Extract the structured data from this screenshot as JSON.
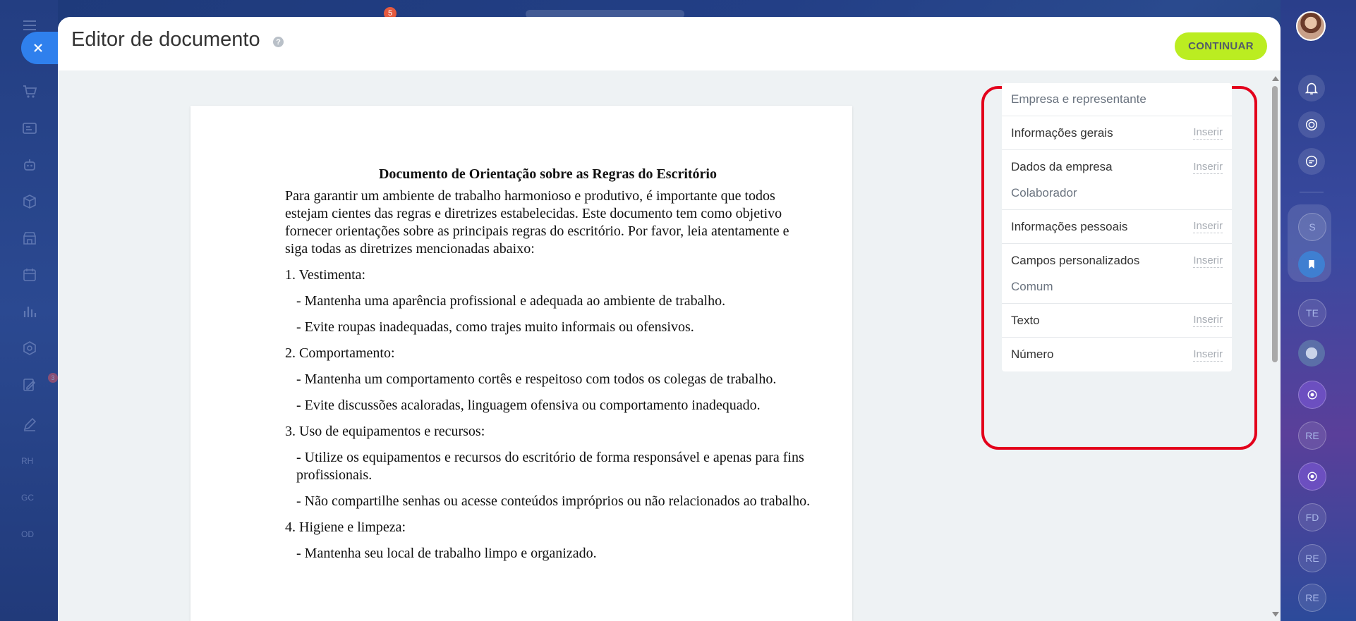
{
  "background": {
    "notification_badge": "5"
  },
  "left_rail": {
    "items": [
      {
        "icon": "cart-icon"
      },
      {
        "icon": "contact-card-icon"
      },
      {
        "icon": "robot-icon"
      },
      {
        "icon": "box-icon"
      },
      {
        "icon": "store-icon"
      },
      {
        "icon": "calendar-icon"
      },
      {
        "icon": "bar-chart-icon"
      },
      {
        "icon": "hexagon-icon"
      },
      {
        "icon": "sign-document-icon",
        "badge": "3"
      },
      {
        "icon": "pen-icon"
      }
    ],
    "text_items": [
      "RH",
      "GC",
      "OD"
    ]
  },
  "right_rail": {
    "avatars": [
      "S",
      "TE",
      "RE",
      "FD",
      "RE",
      "RE"
    ]
  },
  "header": {
    "title": "Editor de documento",
    "help": "?",
    "continue_label": "CONTINUAR"
  },
  "document": {
    "title": "Documento de Orientação sobre as Regras do Escritório",
    "paragraphs": [
      {
        "text": "Para garantir um ambiente de trabalho harmonioso e produtivo, é importante que todos estejam cientes das regras e diretrizes estabelecidas. Este documento tem como objetivo fornecer orientações sobre as principais regras do escritório. Por favor, leia atentamente e siga todas as diretrizes mencionadas abaixo:",
        "indent": false
      },
      {
        "text": "1. Vestimenta:",
        "indent": false
      },
      {
        "text": "- Mantenha uma aparência profissional e adequada ao ambiente de trabalho.",
        "indent": true
      },
      {
        "text": "- Evite roupas inadequadas, como trajes muito informais ou ofensivos.",
        "indent": true
      },
      {
        "text": "2. Comportamento:",
        "indent": false
      },
      {
        "text": "- Mantenha um comportamento cortês e respeitoso com todos os colegas de trabalho.",
        "indent": true
      },
      {
        "text": "- Evite discussões acaloradas, linguagem ofensiva ou comportamento inadequado.",
        "indent": true
      },
      {
        "text": "3. Uso de equipamentos e recursos:",
        "indent": false
      },
      {
        "text": "- Utilize os equipamentos e recursos do escritório de forma responsável e apenas para fins profissionais.",
        "indent": true
      },
      {
        "text": "- Não compartilhe senhas ou acesse conteúdos impróprios ou não relacionados ao trabalho.",
        "indent": true
      },
      {
        "text": "4. Higiene e limpeza:",
        "indent": false
      },
      {
        "text": "- Mantenha seu local de trabalho limpo e organizado.",
        "indent": true
      }
    ]
  },
  "fields_panel": {
    "groups": [
      {
        "title": "Empresa e representante",
        "rows": [
          {
            "label": "Informações gerais",
            "action": "Inserir"
          },
          {
            "label": "Dados da empresa",
            "action": "Inserir"
          }
        ]
      },
      {
        "title": "Colaborador",
        "rows": [
          {
            "label": "Informações pessoais",
            "action": "Inserir"
          },
          {
            "label": "Campos personalizados",
            "action": "Inserir"
          }
        ]
      },
      {
        "title": "Comum",
        "rows": [
          {
            "label": "Texto",
            "action": "Inserir"
          },
          {
            "label": "Número",
            "action": "Inserir"
          }
        ]
      }
    ]
  },
  "colors": {
    "accent_green": "#bbed21",
    "close_blue": "#2f80ed",
    "highlight_red": "#e3001b"
  }
}
